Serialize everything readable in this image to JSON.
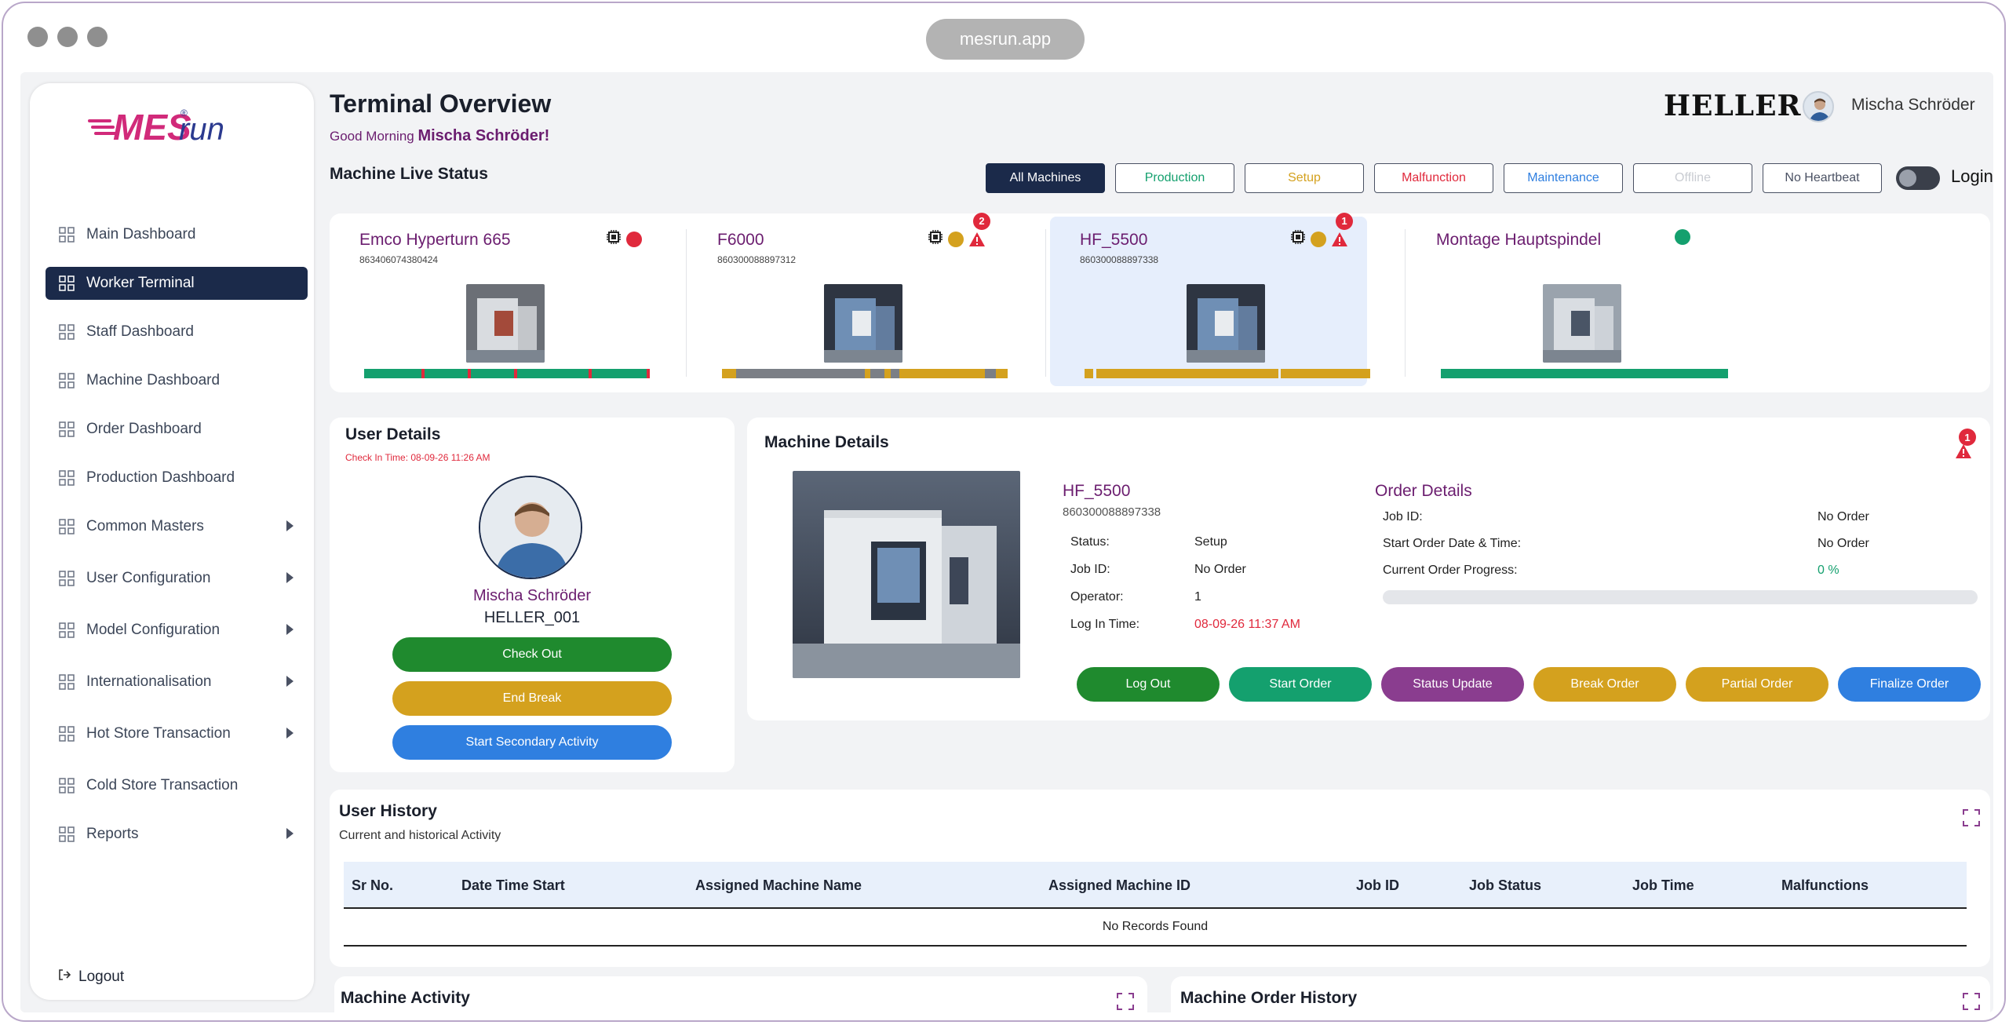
{
  "browser": {
    "url": "mesrun.app"
  },
  "brand": {
    "logo_text_mes": "MES",
    "logo_text_run": "run",
    "reg_mark": "®",
    "partner_logo": "HELLER"
  },
  "colors": {
    "primary": "#1b2a4a",
    "purple": "#6b1d6f",
    "green": "#1f8a2e",
    "teal": "#14a06e",
    "amber": "#d4a11e",
    "red": "#e0293c",
    "grey": "#7b7f86",
    "blue": "#2f7fe0"
  },
  "sidebar": {
    "items": [
      {
        "label": "Main Dashboard",
        "icon": "grid-icon",
        "active": false,
        "submenu": false
      },
      {
        "label": "Worker Terminal",
        "icon": "worker-icon",
        "active": true,
        "submenu": false
      },
      {
        "label": "Staff Dashboard",
        "icon": "staff-icon",
        "active": false,
        "submenu": false
      },
      {
        "label": "Machine Dashboard",
        "icon": "machine-icon",
        "active": false,
        "submenu": false
      },
      {
        "label": "Order Dashboard",
        "icon": "clipboard-icon",
        "active": false,
        "submenu": false
      },
      {
        "label": "Production Dashboard",
        "icon": "production-icon",
        "active": false,
        "submenu": false
      },
      {
        "label": "Common Masters",
        "icon": "gear-icon",
        "active": false,
        "submenu": true
      },
      {
        "label": "User Configuration",
        "icon": "user-gear-icon",
        "active": false,
        "submenu": true
      },
      {
        "label": "Model Configuration",
        "icon": "model-icon",
        "active": false,
        "submenu": true
      },
      {
        "label": "Internationalisation",
        "icon": "language-icon",
        "active": false,
        "submenu": true
      },
      {
        "label": "Hot Store Transaction",
        "icon": "store-icon",
        "active": false,
        "submenu": true
      },
      {
        "label": "Cold Store Transaction",
        "icon": "cold-store-icon",
        "active": false,
        "submenu": false
      },
      {
        "label": "Reports",
        "icon": "report-icon",
        "active": false,
        "submenu": true
      }
    ],
    "logout_label": "Logout"
  },
  "header": {
    "title": "Terminal Overview",
    "greeting_prefix": "Good Morning",
    "greeting_name": "Mischa Schröder!",
    "user_name": "Mischa Schröder"
  },
  "live_status": {
    "title": "Machine Live Status",
    "filters": [
      {
        "label": "All Machines",
        "color": "#ffffff",
        "active": true
      },
      {
        "label": "Production",
        "color": "#14a06e",
        "active": false
      },
      {
        "label": "Setup",
        "color": "#d4a11e",
        "active": false
      },
      {
        "label": "Malfunction",
        "color": "#e0293c",
        "active": false
      },
      {
        "label": "Maintenance",
        "color": "#2f7fe0",
        "active": false
      },
      {
        "label": "Offline",
        "color": "#c9ccd2",
        "active": false
      },
      {
        "label": "No Heartbeat",
        "color": "#4a5163",
        "active": false
      }
    ],
    "login_label": "Login",
    "machines": [
      {
        "name": "Emco Hyperturn 665",
        "id": "863406074380424",
        "status_color": "#e0293c",
        "alerts": "",
        "selected": false,
        "timeline": [
          {
            "c": "#14a06e",
            "w": 20
          },
          {
            "c": "#e0293c",
            "w": 1.2
          },
          {
            "c": "#14a06e",
            "w": 15
          },
          {
            "c": "#e0293c",
            "w": 1.2
          },
          {
            "c": "#14a06e",
            "w": 15
          },
          {
            "c": "#e0293c",
            "w": 1.2
          },
          {
            "c": "#14a06e",
            "w": 25
          },
          {
            "c": "#e0293c",
            "w": 1.2
          },
          {
            "c": "#14a06e",
            "w": 19
          },
          {
            "c": "#e0293c",
            "w": 1.2
          }
        ]
      },
      {
        "name": "F6000",
        "id": "860300088897312",
        "status_color": "#d4a11e",
        "alerts": "2",
        "selected": false,
        "timeline": [
          {
            "c": "#d4a11e",
            "w": 5
          },
          {
            "c": "#7b7f86",
            "w": 45
          },
          {
            "c": "#d4a11e",
            "w": 2
          },
          {
            "c": "#7b7f86",
            "w": 5
          },
          {
            "c": "#d4a11e",
            "w": 2
          },
          {
            "c": "#7b7f86",
            "w": 3
          },
          {
            "c": "#d4a11e",
            "w": 30
          },
          {
            "c": "#7b7f86",
            "w": 4
          },
          {
            "c": "#d4a11e",
            "w": 4
          }
        ]
      },
      {
        "name": "HF_5500",
        "id": "860300088897338",
        "status_color": "#d4a11e",
        "alerts": "1",
        "selected": true,
        "timeline": [
          {
            "c": "#d4a11e",
            "w": 3
          },
          {
            "c": "#e6eefc",
            "w": 1
          },
          {
            "c": "#d4a11e",
            "w": 64
          },
          {
            "c": "#e6eefc",
            "w": 0.6
          },
          {
            "c": "#d4a11e",
            "w": 31.4
          }
        ]
      },
      {
        "name": "Montage Hauptspindel",
        "id": "",
        "status_color": "#14a06e",
        "alerts": "",
        "selected": false,
        "timeline": [
          {
            "c": "#14a06e",
            "w": 100
          }
        ]
      }
    ]
  },
  "user_details": {
    "title": "User Details",
    "check_in": "Check In Time: 08-09-26 11:26 AM",
    "name": "Mischa Schröder",
    "code": "HELLER_001",
    "buttons": [
      {
        "label": "Check Out",
        "color": "#1f8a2e"
      },
      {
        "label": "End Break",
        "color": "#d4a11e"
      },
      {
        "label": "Start Secondary Activity",
        "color": "#2f7fe0"
      }
    ]
  },
  "machine_details": {
    "title": "Machine Details",
    "alert_count": "1",
    "name": "HF_5500",
    "id": "860300088897338",
    "fields": [
      {
        "label": "Status:",
        "value": "Setup",
        "value_color": "#222"
      },
      {
        "label": "Job ID:",
        "value": "No Order",
        "value_color": "#222"
      },
      {
        "label": "Operator:",
        "value": "1",
        "value_color": "#222"
      },
      {
        "label": "Log In Time:",
        "value": "08-09-26 11:37 AM",
        "value_color": "#e0293c"
      }
    ],
    "order": {
      "title": "Order Details",
      "fields": [
        {
          "label": "Job ID:",
          "value": "No Order"
        },
        {
          "label": "Start Order Date & Time:",
          "value": "No Order"
        },
        {
          "label": "Current Order Progress:",
          "value": "0 %"
        }
      ],
      "progress": 0
    },
    "buttons": [
      {
        "label": "Log Out",
        "color": "#1f8a2e"
      },
      {
        "label": "Start Order",
        "color": "#14a06e"
      },
      {
        "label": "Status Update",
        "color": "#8a3d8f"
      },
      {
        "label": "Break Order",
        "color": "#d4a11e"
      },
      {
        "label": "Partial Order",
        "color": "#d4a11e"
      },
      {
        "label": "Finalize Order",
        "color": "#2f7fe0"
      }
    ]
  },
  "user_history": {
    "title": "User History",
    "subtitle": "Current and historical Activity",
    "columns": [
      "Sr No.",
      "Date Time Start",
      "Assigned Machine Name",
      "Assigned Machine ID",
      "Job ID",
      "Job Status",
      "Job Time",
      "Malfunctions"
    ],
    "empty": "No Records Found"
  },
  "machine_activity": {
    "title": "Machine Activity"
  },
  "machine_order_history": {
    "title": "Machine Order History"
  }
}
